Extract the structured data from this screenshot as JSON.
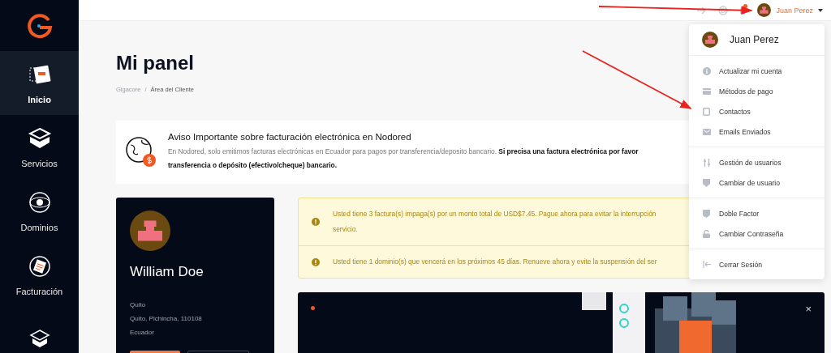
{
  "sidebar": {
    "items": [
      {
        "label": "Inicio",
        "selected": true,
        "kind": "home"
      },
      {
        "label": "Servicios",
        "selected": false,
        "kind": "box"
      },
      {
        "label": "Dominios",
        "selected": false,
        "kind": "globe"
      },
      {
        "label": "Facturación",
        "selected": false,
        "kind": "invoice"
      },
      {
        "selected": false,
        "kind": "support"
      }
    ]
  },
  "topbar": {
    "user_name": "Juan Perez",
    "has_notifications": true
  },
  "page": {
    "title": "Mi panel",
    "breadcrumb": [
      "Gigacore",
      "Área del Cliente"
    ],
    "breadcrumb_separator": "/"
  },
  "banner": {
    "close_label": "×"
  },
  "notice": {
    "title": "Aviso Importante sobre facturación electrónica en Nodored",
    "lines": [
      "En Nodored, solo emitimos facturas electrónicas en Ecuador para pagos por transferencia/deposito bancario. **Si precisa una factura electrónica por favor**",
      "**transferencia o depósito (efectivo/cheque) bancario.**"
    ]
  },
  "profile": {
    "name": "William Doe",
    "address": [
      "Quito",
      "Quito, Pichincha, 110108",
      "Ecuador"
    ]
  },
  "alerts": [
    {
      "lines": [
        "Usted tiene 3 factura(s) impaga(s) por un monto total de USD$7.45. Pague ahora para evitar la interrupción",
        "servicio."
      ]
    },
    {
      "lines": [
        "Usted tiene 1 dominio(s) que vencerá en los próximos 45 días. Renueve ahora y evite la suspensión del ser"
      ]
    }
  ],
  "user_menu": {
    "name": "Juan Perez",
    "groups": [
      [
        {
          "label": "Actualizar mi cuenta",
          "kind": "info"
        },
        {
          "label": "Métodos de pago",
          "kind": "card"
        },
        {
          "label": "Contactos",
          "kind": "contact"
        },
        {
          "label": "Emails Enviados",
          "kind": "mail"
        }
      ],
      [
        {
          "label": "Gestión de usuarios",
          "kind": "users"
        },
        {
          "label": "Cambiar de usuario",
          "kind": "switch"
        }
      ],
      [
        {
          "label": "Doble Factor",
          "kind": "shield"
        },
        {
          "label": "Cambiar Contraseña",
          "kind": "lock"
        }
      ],
      [
        {
          "label": "Cerrar Sesión",
          "kind": "logout"
        }
      ]
    ]
  }
}
